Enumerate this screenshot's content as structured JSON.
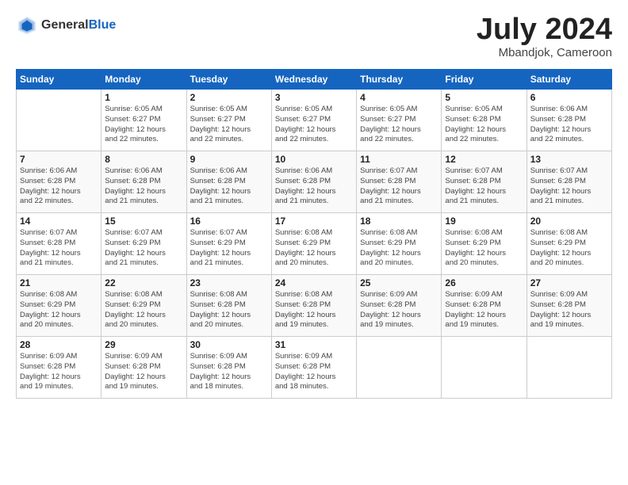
{
  "logo": {
    "general": "General",
    "blue": "Blue"
  },
  "header": {
    "month": "July 2024",
    "location": "Mbandjok, Cameroon"
  },
  "days_of_week": [
    "Sunday",
    "Monday",
    "Tuesday",
    "Wednesday",
    "Thursday",
    "Friday",
    "Saturday"
  ],
  "weeks": [
    [
      {
        "day": "",
        "info": ""
      },
      {
        "day": "1",
        "info": "Sunrise: 6:05 AM\nSunset: 6:27 PM\nDaylight: 12 hours\nand 22 minutes."
      },
      {
        "day": "2",
        "info": "Sunrise: 6:05 AM\nSunset: 6:27 PM\nDaylight: 12 hours\nand 22 minutes."
      },
      {
        "day": "3",
        "info": "Sunrise: 6:05 AM\nSunset: 6:27 PM\nDaylight: 12 hours\nand 22 minutes."
      },
      {
        "day": "4",
        "info": "Sunrise: 6:05 AM\nSunset: 6:27 PM\nDaylight: 12 hours\nand 22 minutes."
      },
      {
        "day": "5",
        "info": "Sunrise: 6:05 AM\nSunset: 6:28 PM\nDaylight: 12 hours\nand 22 minutes."
      },
      {
        "day": "6",
        "info": "Sunrise: 6:06 AM\nSunset: 6:28 PM\nDaylight: 12 hours\nand 22 minutes."
      }
    ],
    [
      {
        "day": "7",
        "info": "Sunrise: 6:06 AM\nSunset: 6:28 PM\nDaylight: 12 hours\nand 22 minutes."
      },
      {
        "day": "8",
        "info": "Sunrise: 6:06 AM\nSunset: 6:28 PM\nDaylight: 12 hours\nand 21 minutes."
      },
      {
        "day": "9",
        "info": "Sunrise: 6:06 AM\nSunset: 6:28 PM\nDaylight: 12 hours\nand 21 minutes."
      },
      {
        "day": "10",
        "info": "Sunrise: 6:06 AM\nSunset: 6:28 PM\nDaylight: 12 hours\nand 21 minutes."
      },
      {
        "day": "11",
        "info": "Sunrise: 6:07 AM\nSunset: 6:28 PM\nDaylight: 12 hours\nand 21 minutes."
      },
      {
        "day": "12",
        "info": "Sunrise: 6:07 AM\nSunset: 6:28 PM\nDaylight: 12 hours\nand 21 minutes."
      },
      {
        "day": "13",
        "info": "Sunrise: 6:07 AM\nSunset: 6:28 PM\nDaylight: 12 hours\nand 21 minutes."
      }
    ],
    [
      {
        "day": "14",
        "info": "Sunrise: 6:07 AM\nSunset: 6:28 PM\nDaylight: 12 hours\nand 21 minutes."
      },
      {
        "day": "15",
        "info": "Sunrise: 6:07 AM\nSunset: 6:29 PM\nDaylight: 12 hours\nand 21 minutes."
      },
      {
        "day": "16",
        "info": "Sunrise: 6:07 AM\nSunset: 6:29 PM\nDaylight: 12 hours\nand 21 minutes."
      },
      {
        "day": "17",
        "info": "Sunrise: 6:08 AM\nSunset: 6:29 PM\nDaylight: 12 hours\nand 20 minutes."
      },
      {
        "day": "18",
        "info": "Sunrise: 6:08 AM\nSunset: 6:29 PM\nDaylight: 12 hours\nand 20 minutes."
      },
      {
        "day": "19",
        "info": "Sunrise: 6:08 AM\nSunset: 6:29 PM\nDaylight: 12 hours\nand 20 minutes."
      },
      {
        "day": "20",
        "info": "Sunrise: 6:08 AM\nSunset: 6:29 PM\nDaylight: 12 hours\nand 20 minutes."
      }
    ],
    [
      {
        "day": "21",
        "info": "Sunrise: 6:08 AM\nSunset: 6:29 PM\nDaylight: 12 hours\nand 20 minutes."
      },
      {
        "day": "22",
        "info": "Sunrise: 6:08 AM\nSunset: 6:29 PM\nDaylight: 12 hours\nand 20 minutes."
      },
      {
        "day": "23",
        "info": "Sunrise: 6:08 AM\nSunset: 6:28 PM\nDaylight: 12 hours\nand 20 minutes."
      },
      {
        "day": "24",
        "info": "Sunrise: 6:08 AM\nSunset: 6:28 PM\nDaylight: 12 hours\nand 19 minutes."
      },
      {
        "day": "25",
        "info": "Sunrise: 6:09 AM\nSunset: 6:28 PM\nDaylight: 12 hours\nand 19 minutes."
      },
      {
        "day": "26",
        "info": "Sunrise: 6:09 AM\nSunset: 6:28 PM\nDaylight: 12 hours\nand 19 minutes."
      },
      {
        "day": "27",
        "info": "Sunrise: 6:09 AM\nSunset: 6:28 PM\nDaylight: 12 hours\nand 19 minutes."
      }
    ],
    [
      {
        "day": "28",
        "info": "Sunrise: 6:09 AM\nSunset: 6:28 PM\nDaylight: 12 hours\nand 19 minutes."
      },
      {
        "day": "29",
        "info": "Sunrise: 6:09 AM\nSunset: 6:28 PM\nDaylight: 12 hours\nand 19 minutes."
      },
      {
        "day": "30",
        "info": "Sunrise: 6:09 AM\nSunset: 6:28 PM\nDaylight: 12 hours\nand 18 minutes."
      },
      {
        "day": "31",
        "info": "Sunrise: 6:09 AM\nSunset: 6:28 PM\nDaylight: 12 hours\nand 18 minutes."
      },
      {
        "day": "",
        "info": ""
      },
      {
        "day": "",
        "info": ""
      },
      {
        "day": "",
        "info": ""
      }
    ]
  ]
}
